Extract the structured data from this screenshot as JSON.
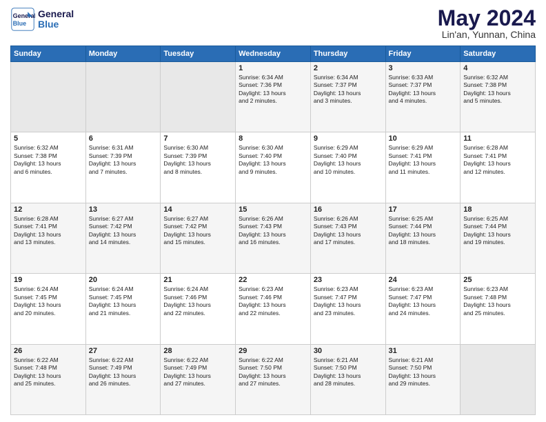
{
  "header": {
    "logo_line1": "General",
    "logo_line2": "Blue",
    "title": "May 2024",
    "subtitle": "Lin'an, Yunnan, China"
  },
  "weekdays": [
    "Sunday",
    "Monday",
    "Tuesday",
    "Wednesday",
    "Thursday",
    "Friday",
    "Saturday"
  ],
  "weeks": [
    [
      {
        "day": "",
        "info": "",
        "empty": true
      },
      {
        "day": "",
        "info": "",
        "empty": true
      },
      {
        "day": "",
        "info": "",
        "empty": true
      },
      {
        "day": "1",
        "info": "Sunrise: 6:34 AM\nSunset: 7:36 PM\nDaylight: 13 hours\nand 2 minutes."
      },
      {
        "day": "2",
        "info": "Sunrise: 6:34 AM\nSunset: 7:37 PM\nDaylight: 13 hours\nand 3 minutes."
      },
      {
        "day": "3",
        "info": "Sunrise: 6:33 AM\nSunset: 7:37 PM\nDaylight: 13 hours\nand 4 minutes."
      },
      {
        "day": "4",
        "info": "Sunrise: 6:32 AM\nSunset: 7:38 PM\nDaylight: 13 hours\nand 5 minutes."
      }
    ],
    [
      {
        "day": "5",
        "info": "Sunrise: 6:32 AM\nSunset: 7:38 PM\nDaylight: 13 hours\nand 6 minutes."
      },
      {
        "day": "6",
        "info": "Sunrise: 6:31 AM\nSunset: 7:39 PM\nDaylight: 13 hours\nand 7 minutes."
      },
      {
        "day": "7",
        "info": "Sunrise: 6:30 AM\nSunset: 7:39 PM\nDaylight: 13 hours\nand 8 minutes."
      },
      {
        "day": "8",
        "info": "Sunrise: 6:30 AM\nSunset: 7:40 PM\nDaylight: 13 hours\nand 9 minutes."
      },
      {
        "day": "9",
        "info": "Sunrise: 6:29 AM\nSunset: 7:40 PM\nDaylight: 13 hours\nand 10 minutes."
      },
      {
        "day": "10",
        "info": "Sunrise: 6:29 AM\nSunset: 7:41 PM\nDaylight: 13 hours\nand 11 minutes."
      },
      {
        "day": "11",
        "info": "Sunrise: 6:28 AM\nSunset: 7:41 PM\nDaylight: 13 hours\nand 12 minutes."
      }
    ],
    [
      {
        "day": "12",
        "info": "Sunrise: 6:28 AM\nSunset: 7:41 PM\nDaylight: 13 hours\nand 13 minutes."
      },
      {
        "day": "13",
        "info": "Sunrise: 6:27 AM\nSunset: 7:42 PM\nDaylight: 13 hours\nand 14 minutes."
      },
      {
        "day": "14",
        "info": "Sunrise: 6:27 AM\nSunset: 7:42 PM\nDaylight: 13 hours\nand 15 minutes."
      },
      {
        "day": "15",
        "info": "Sunrise: 6:26 AM\nSunset: 7:43 PM\nDaylight: 13 hours\nand 16 minutes."
      },
      {
        "day": "16",
        "info": "Sunrise: 6:26 AM\nSunset: 7:43 PM\nDaylight: 13 hours\nand 17 minutes."
      },
      {
        "day": "17",
        "info": "Sunrise: 6:25 AM\nSunset: 7:44 PM\nDaylight: 13 hours\nand 18 minutes."
      },
      {
        "day": "18",
        "info": "Sunrise: 6:25 AM\nSunset: 7:44 PM\nDaylight: 13 hours\nand 19 minutes."
      }
    ],
    [
      {
        "day": "19",
        "info": "Sunrise: 6:24 AM\nSunset: 7:45 PM\nDaylight: 13 hours\nand 20 minutes."
      },
      {
        "day": "20",
        "info": "Sunrise: 6:24 AM\nSunset: 7:45 PM\nDaylight: 13 hours\nand 21 minutes."
      },
      {
        "day": "21",
        "info": "Sunrise: 6:24 AM\nSunset: 7:46 PM\nDaylight: 13 hours\nand 22 minutes."
      },
      {
        "day": "22",
        "info": "Sunrise: 6:23 AM\nSunset: 7:46 PM\nDaylight: 13 hours\nand 22 minutes."
      },
      {
        "day": "23",
        "info": "Sunrise: 6:23 AM\nSunset: 7:47 PM\nDaylight: 13 hours\nand 23 minutes."
      },
      {
        "day": "24",
        "info": "Sunrise: 6:23 AM\nSunset: 7:47 PM\nDaylight: 13 hours\nand 24 minutes."
      },
      {
        "day": "25",
        "info": "Sunrise: 6:23 AM\nSunset: 7:48 PM\nDaylight: 13 hours\nand 25 minutes."
      }
    ],
    [
      {
        "day": "26",
        "info": "Sunrise: 6:22 AM\nSunset: 7:48 PM\nDaylight: 13 hours\nand 25 minutes."
      },
      {
        "day": "27",
        "info": "Sunrise: 6:22 AM\nSunset: 7:49 PM\nDaylight: 13 hours\nand 26 minutes."
      },
      {
        "day": "28",
        "info": "Sunrise: 6:22 AM\nSunset: 7:49 PM\nDaylight: 13 hours\nand 27 minutes."
      },
      {
        "day": "29",
        "info": "Sunrise: 6:22 AM\nSunset: 7:50 PM\nDaylight: 13 hours\nand 27 minutes."
      },
      {
        "day": "30",
        "info": "Sunrise: 6:21 AM\nSunset: 7:50 PM\nDaylight: 13 hours\nand 28 minutes."
      },
      {
        "day": "31",
        "info": "Sunrise: 6:21 AM\nSunset: 7:50 PM\nDaylight: 13 hours\nand 29 minutes."
      },
      {
        "day": "",
        "info": "",
        "empty": true
      }
    ]
  ]
}
